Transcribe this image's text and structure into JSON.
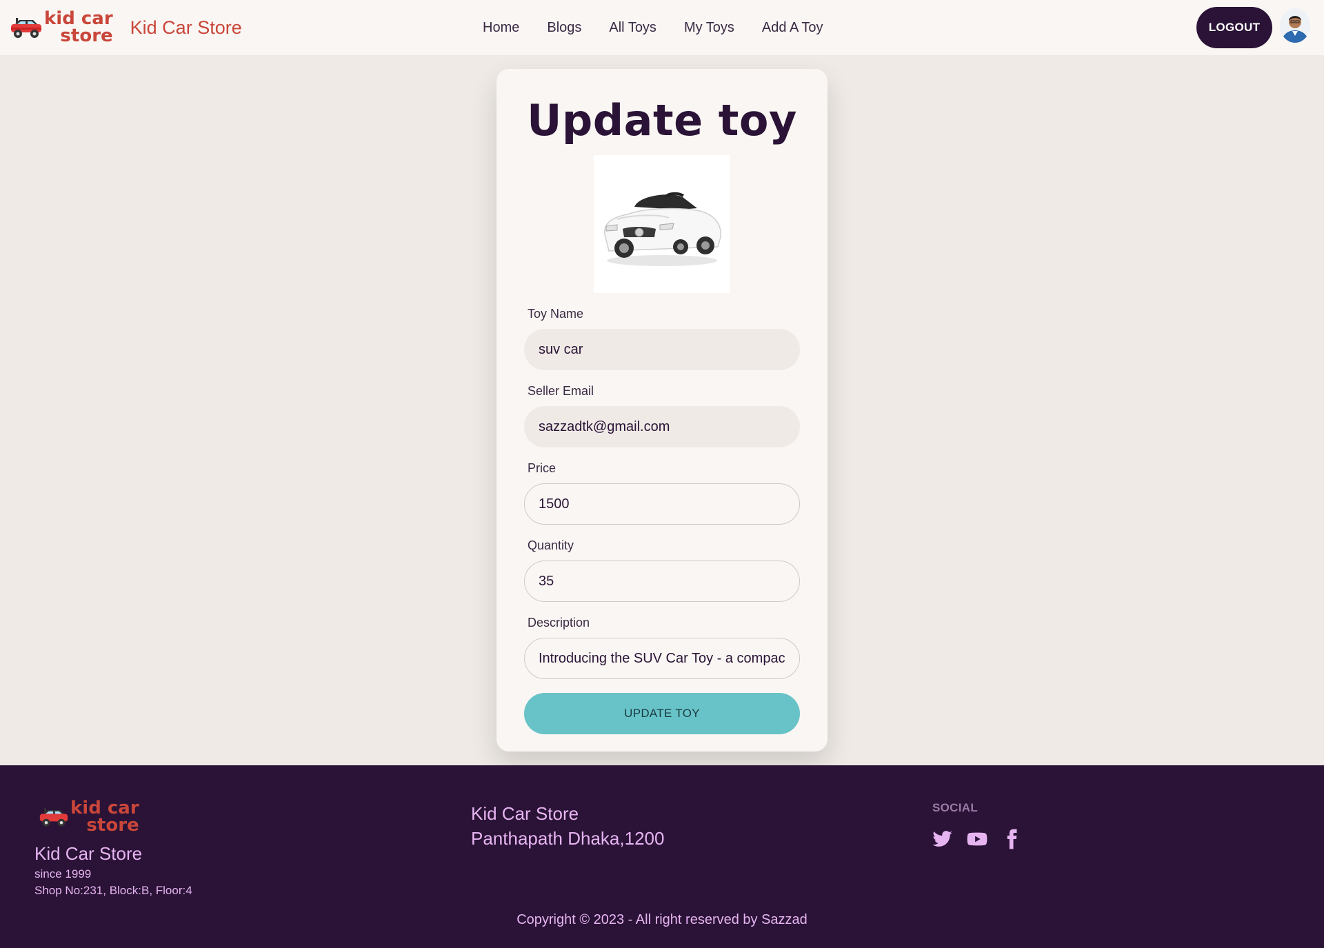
{
  "header": {
    "logo_line1": "kid car",
    "logo_line2": "store",
    "brand_name": "Kid Car Store",
    "nav": [
      "Home",
      "Blogs",
      "All Toys",
      "My Toys",
      "Add A Toy"
    ],
    "logout_label": "LOGOUT"
  },
  "form": {
    "title": "Update toy",
    "toy_name_label": "Toy Name",
    "toy_name_value": "suv car",
    "seller_email_label": "Seller Email",
    "seller_email_value": "sazzadtk@gmail.com",
    "price_label": "Price",
    "price_value": "1500",
    "quantity_label": "Quantity",
    "quantity_value": "35",
    "description_label": "Description",
    "description_value": "Introducing the SUV Car Toy - a compact",
    "submit_label": "UPDATE TOY"
  },
  "footer": {
    "logo_line1": "kid car",
    "logo_line2": "store",
    "name": "Kid Car Store",
    "since": "since 1999",
    "shop": "Shop No:231, Block:B, Floor:4",
    "store_name": "Kid Car Store",
    "address": "Panthapath Dhaka,1200",
    "social_title": "SOCIAL",
    "social_icons": [
      "twitter-icon",
      "youtube-icon",
      "facebook-icon"
    ],
    "copyright": "Copyright © 2023 - All right reserved by Sazzad"
  },
  "colors": {
    "brand_red": "#c9463a",
    "dark_purple": "#2a1336",
    "teal_button": "#67c3c7",
    "footer_text": "#e7b4f2",
    "page_bg": "#efeae6"
  }
}
